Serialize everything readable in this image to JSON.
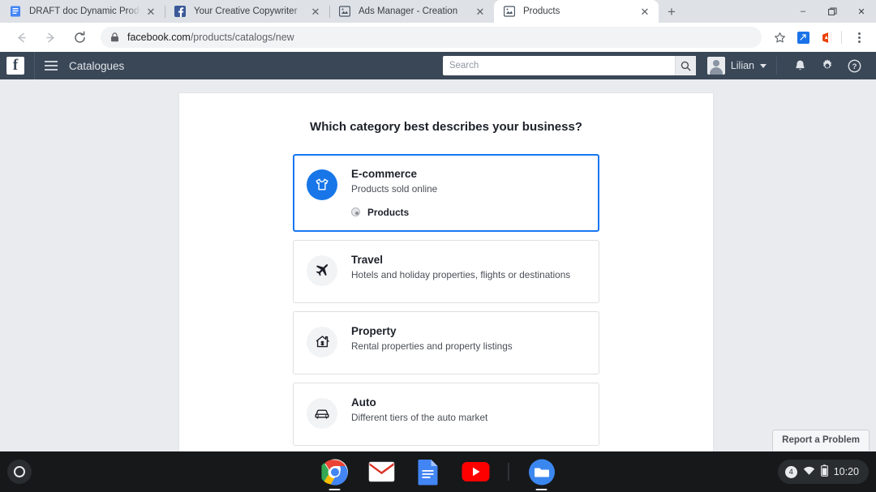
{
  "browser": {
    "tabs": [
      {
        "title": "DRAFT doc Dynamic Product Ads",
        "favicon": "google-docs-icon",
        "active": false
      },
      {
        "title": "Your Creative Copywriter",
        "favicon": "facebook-icon",
        "active": false
      },
      {
        "title": "Ads Manager - Creation",
        "favicon": "facebook-business-icon",
        "active": false
      },
      {
        "title": "Products",
        "favicon": "facebook-business-icon",
        "active": true
      }
    ],
    "new_tab_label": "+",
    "close_label": "✕",
    "window_controls": {
      "minimize": "–",
      "maximize": "❐",
      "close": "✕"
    },
    "nav": {
      "back": "←",
      "forward": "→",
      "reload": "⟳"
    },
    "url": {
      "host": "facebook.com",
      "path": "/products/catalogs/new",
      "lock_icon": "lock-icon"
    },
    "omni_icons": [
      "bookmark-star-icon",
      "extension-icon",
      "office-icon",
      "chrome-menu-icon"
    ]
  },
  "fbheader": {
    "logo": "f",
    "menu_icon": "hamburger-menu-icon",
    "title": "Catalogues",
    "search": {
      "placeholder": "Search",
      "value": "",
      "button_icon": "search-icon"
    },
    "account": {
      "name": "Lilian",
      "avatar": "user-avatar",
      "caret": "chevron-down-icon"
    },
    "icons": [
      "notifications-bell-icon",
      "settings-gear-icon",
      "help-question-icon"
    ]
  },
  "main": {
    "heading": "Which category best describes your business?",
    "options": [
      {
        "title": "E-commerce",
        "description": "Products sold online",
        "icon": "tshirt-icon",
        "selected": true,
        "suboptions": [
          {
            "label": "Products",
            "selected": true
          }
        ]
      },
      {
        "title": "Travel",
        "description": "Hotels and holiday properties, flights or destinations",
        "icon": "airplane-icon",
        "selected": false,
        "suboptions": []
      },
      {
        "title": "Property",
        "description": "Rental properties and property listings",
        "icon": "house-dollar-icon",
        "selected": false,
        "suboptions": []
      },
      {
        "title": "Auto",
        "description": "Different tiers of the auto market",
        "icon": "car-icon",
        "selected": false,
        "suboptions": []
      }
    ],
    "report_button": "Report a Problem"
  },
  "shelf": {
    "launcher": "launcher-icon",
    "apps": [
      {
        "name": "chrome-app-icon",
        "running": true
      },
      {
        "name": "gmail-app-icon",
        "running": false
      },
      {
        "name": "google-docs-app-icon",
        "running": false
      },
      {
        "name": "youtube-app-icon",
        "running": false
      },
      {
        "name": "files-app-icon",
        "running": true
      }
    ],
    "tray": {
      "badge": "4",
      "wifi": "wifi-icon",
      "battery": "battery-icon",
      "time": "10:20"
    }
  },
  "colors": {
    "fb_blue": "#1876e8",
    "header_bg": "#3a4757",
    "page_bg": "#e9ebee",
    "selected_border": "#1877f2"
  }
}
